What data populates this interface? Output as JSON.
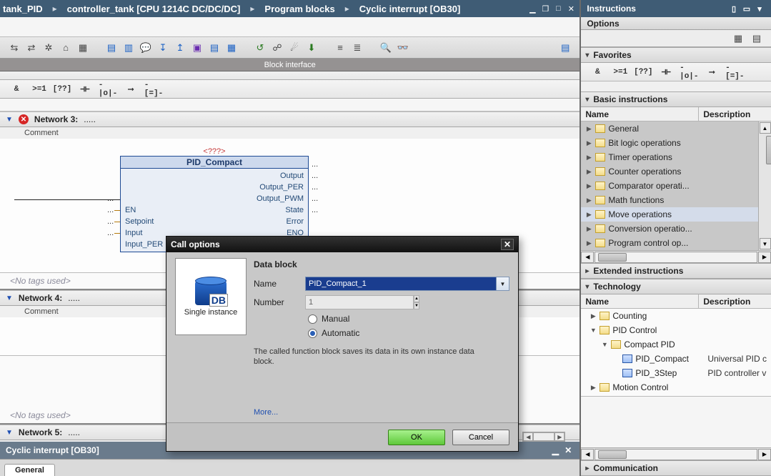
{
  "breadcrumb": [
    "tank_PID",
    "controller_tank [CPU 1214C DC/DC/DC]",
    "Program blocks",
    "Cyclic interrupt [OB30]"
  ],
  "block_interface": "Block interface",
  "ladder_ops": [
    "&",
    ">=1",
    "[??]",
    "⊣⊢",
    "-|o|-",
    "⟶",
    "-[=]-"
  ],
  "networks": [
    {
      "title": "Network 3:",
      "dots": ".....",
      "comment": "Comment",
      "error": true,
      "fb": {
        "type_label": "<???>",
        "name": "PID_Compact",
        "left_pins": [
          "EN",
          "Setpoint",
          "Input",
          "Input_PER"
        ],
        "right_pins": [
          "Output",
          "Output_PER",
          "Output_PWM",
          "State",
          "Error",
          "ENO"
        ]
      }
    },
    {
      "title": "Network 4:",
      "dots": ".....",
      "comment": "Comment"
    },
    {
      "title": "Network 5:",
      "dots": "....."
    }
  ],
  "no_tags": "<No tags used>",
  "footer_title": "Cyclic interrupt [OB30]",
  "footer_tab": "General",
  "dialog": {
    "title": "Call options",
    "option_card": "Single instance",
    "db_label": "DB",
    "data_block": "Data block",
    "name_label": "Name",
    "name_value": "PID_Compact_1",
    "number_label": "Number",
    "number_value": "1",
    "manual": "Manual",
    "automatic": "Automatic",
    "hint": "The called function block saves its data in its own instance data block.",
    "more": "More...",
    "ok": "OK",
    "cancel": "Cancel"
  },
  "right": {
    "title": "Instructions",
    "options": "Options",
    "lad_ops": [
      "&",
      ">=1",
      "[??]",
      "⊣⊢",
      "-|o|-",
      "⟶",
      "-[=]-"
    ],
    "sections": {
      "favorites": "Favorites",
      "basic": "Basic instructions",
      "extended": "Extended instructions",
      "technology": "Technology",
      "communication": "Communication"
    },
    "cols": {
      "name": "Name",
      "desc": "Description"
    },
    "basic_items": [
      {
        "label": "General",
        "icon": "folder"
      },
      {
        "label": "Bit logic operations",
        "icon": "folder"
      },
      {
        "label": "Timer operations",
        "icon": "folder"
      },
      {
        "label": "Counter operations",
        "icon": "folder"
      },
      {
        "label": "Comparator operati...",
        "icon": "folder"
      },
      {
        "label": "Math functions",
        "icon": "folder"
      },
      {
        "label": "Move operations",
        "icon": "folder"
      },
      {
        "label": "Conversion operatio...",
        "icon": "folder"
      },
      {
        "label": "Program control op...",
        "icon": "folder"
      }
    ],
    "tech_items": [
      {
        "label": "Counting",
        "lvl": 0,
        "tri": "▶",
        "icon": "folder"
      },
      {
        "label": "PID Control",
        "lvl": 0,
        "tri": "▼",
        "icon": "folder"
      },
      {
        "label": "Compact PID",
        "lvl": 1,
        "tri": "▼",
        "icon": "folder"
      },
      {
        "label": "PID_Compact",
        "lvl": 2,
        "tri": "",
        "icon": "leaf",
        "desc": "Universal PID c"
      },
      {
        "label": "PID_3Step",
        "lvl": 2,
        "tri": "",
        "icon": "leaf",
        "desc": "PID controller v"
      },
      {
        "label": "Motion Control",
        "lvl": 0,
        "tri": "▶",
        "icon": "folder"
      }
    ]
  }
}
